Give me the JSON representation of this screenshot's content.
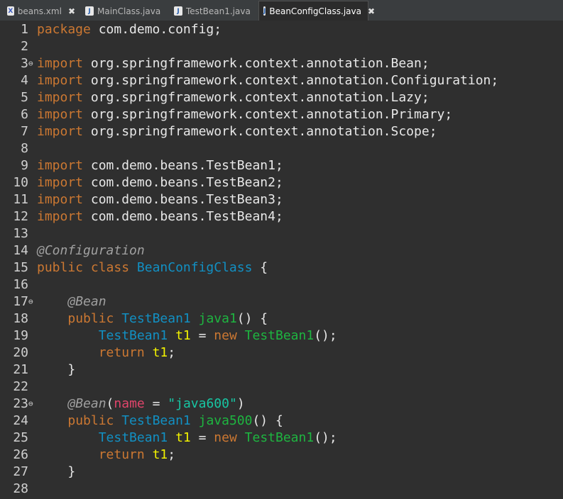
{
  "tabs": [
    {
      "label": "beans.xml",
      "icon": "xml-file-icon",
      "closable": true,
      "active": false
    },
    {
      "label": "MainClass.java",
      "icon": "java-file-icon",
      "closable": false,
      "active": false
    },
    {
      "label": "TestBean1.java",
      "icon": "java-file-icon",
      "closable": false,
      "active": false
    },
    {
      "label": "BeanConfigClass.java",
      "icon": "java-file-icon",
      "closable": true,
      "active": true
    }
  ],
  "colors": {
    "background": "#2f2f2f",
    "keyword": "#cc7832",
    "annotation": "#a0a0a0",
    "class": "#1290c3",
    "method": "#1eb540",
    "variable": "#f2f200",
    "string": "#17c6a3",
    "param": "#e0456b"
  },
  "code_lines": [
    {
      "num": "1",
      "fold": "",
      "tokens": [
        [
          "kw",
          "package"
        ],
        [
          "plain",
          " com.demo.config;"
        ]
      ]
    },
    {
      "num": "2",
      "fold": "",
      "tokens": []
    },
    {
      "num": "3",
      "fold": "⊖",
      "tokens": [
        [
          "kw",
          "import"
        ],
        [
          "plain",
          " org.springframework.context.annotation.Bean;"
        ]
      ]
    },
    {
      "num": "4",
      "fold": "",
      "tokens": [
        [
          "kw",
          "import"
        ],
        [
          "plain",
          " org.springframework.context.annotation.Configuration;"
        ]
      ]
    },
    {
      "num": "5",
      "fold": "",
      "tokens": [
        [
          "kw",
          "import"
        ],
        [
          "plain",
          " org.springframework.context.annotation.Lazy;"
        ]
      ]
    },
    {
      "num": "6",
      "fold": "",
      "tokens": [
        [
          "kw",
          "import"
        ],
        [
          "plain",
          " org.springframework.context.annotation.Primary;"
        ]
      ]
    },
    {
      "num": "7",
      "fold": "",
      "tokens": [
        [
          "kw",
          "import"
        ],
        [
          "plain",
          " org.springframework.context.annotation.Scope;"
        ]
      ]
    },
    {
      "num": "8",
      "fold": "",
      "tokens": []
    },
    {
      "num": "9",
      "fold": "",
      "tokens": [
        [
          "kw",
          "import"
        ],
        [
          "plain",
          " com.demo.beans.TestBean1;"
        ]
      ]
    },
    {
      "num": "10",
      "fold": "",
      "tokens": [
        [
          "kw",
          "import"
        ],
        [
          "plain",
          " com.demo.beans.TestBean2;"
        ]
      ]
    },
    {
      "num": "11",
      "fold": "",
      "tokens": [
        [
          "kw",
          "import"
        ],
        [
          "plain",
          " com.demo.beans.TestBean3;"
        ]
      ]
    },
    {
      "num": "12",
      "fold": "",
      "tokens": [
        [
          "kw",
          "import"
        ],
        [
          "plain",
          " com.demo.beans.TestBean4;"
        ]
      ]
    },
    {
      "num": "13",
      "fold": "",
      "tokens": []
    },
    {
      "num": "14",
      "fold": "",
      "tokens": [
        [
          "ann",
          "@Configuration"
        ]
      ]
    },
    {
      "num": "15",
      "fold": "",
      "tokens": [
        [
          "kw",
          "public class "
        ],
        [
          "cls",
          "BeanConfigClass"
        ],
        [
          "plain",
          " {"
        ]
      ]
    },
    {
      "num": "16",
      "fold": "",
      "tokens": []
    },
    {
      "num": "17",
      "fold": "⊖",
      "tokens": [
        [
          "plain",
          "    "
        ],
        [
          "ann",
          "@Bean"
        ]
      ]
    },
    {
      "num": "18",
      "fold": "",
      "tokens": [
        [
          "plain",
          "    "
        ],
        [
          "kw",
          "public "
        ],
        [
          "cls",
          "TestBean1"
        ],
        [
          "plain",
          " "
        ],
        [
          "meth",
          "java1"
        ],
        [
          "plain",
          "() {"
        ]
      ]
    },
    {
      "num": "19",
      "fold": "",
      "tokens": [
        [
          "plain",
          "        "
        ],
        [
          "cls",
          "TestBean1"
        ],
        [
          "plain",
          " "
        ],
        [
          "var",
          "t1"
        ],
        [
          "plain",
          " = "
        ],
        [
          "kw",
          "new "
        ],
        [
          "meth",
          "TestBean1"
        ],
        [
          "plain",
          "();"
        ]
      ]
    },
    {
      "num": "20",
      "fold": "",
      "tokens": [
        [
          "plain",
          "        "
        ],
        [
          "kw",
          "return "
        ],
        [
          "var",
          "t1"
        ],
        [
          "plain",
          ";"
        ]
      ]
    },
    {
      "num": "21",
      "fold": "",
      "tokens": [
        [
          "plain",
          "    }"
        ]
      ]
    },
    {
      "num": "22",
      "fold": "",
      "tokens": []
    },
    {
      "num": "23",
      "fold": "⊖",
      "tokens": [
        [
          "plain",
          "    "
        ],
        [
          "ann",
          "@Bean"
        ],
        [
          "plain",
          "("
        ],
        [
          "param",
          "name"
        ],
        [
          "plain",
          " = "
        ],
        [
          "str",
          "\"java600\""
        ],
        [
          "plain",
          ")"
        ]
      ]
    },
    {
      "num": "24",
      "fold": "",
      "tokens": [
        [
          "plain",
          "    "
        ],
        [
          "kw",
          "public "
        ],
        [
          "cls",
          "TestBean1"
        ],
        [
          "plain",
          " "
        ],
        [
          "meth",
          "java500"
        ],
        [
          "plain",
          "() {"
        ]
      ]
    },
    {
      "num": "25",
      "fold": "",
      "tokens": [
        [
          "plain",
          "        "
        ],
        [
          "cls",
          "TestBean1"
        ],
        [
          "plain",
          " "
        ],
        [
          "var",
          "t1"
        ],
        [
          "plain",
          " = "
        ],
        [
          "kw",
          "new "
        ],
        [
          "meth",
          "TestBean1"
        ],
        [
          "plain",
          "();"
        ]
      ]
    },
    {
      "num": "26",
      "fold": "",
      "tokens": [
        [
          "plain",
          "        "
        ],
        [
          "kw",
          "return "
        ],
        [
          "var",
          "t1"
        ],
        [
          "plain",
          ";"
        ]
      ]
    },
    {
      "num": "27",
      "fold": "",
      "tokens": [
        [
          "plain",
          "    }"
        ]
      ]
    },
    {
      "num": "28",
      "fold": "",
      "tokens": []
    }
  ]
}
